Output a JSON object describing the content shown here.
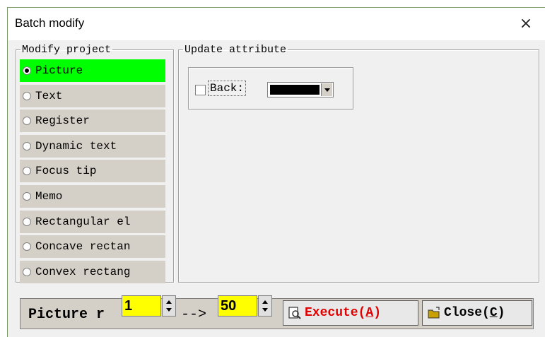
{
  "window": {
    "title": "Batch modify",
    "close_glyph": "×"
  },
  "modify_project": {
    "legend": "Modify project",
    "items": [
      {
        "label": "Picture",
        "selected": true
      },
      {
        "label": "Text",
        "selected": false
      },
      {
        "label": "Register",
        "selected": false
      },
      {
        "label": "Dynamic text",
        "selected": false
      },
      {
        "label": "Focus tip",
        "selected": false
      },
      {
        "label": "Memo",
        "selected": false
      },
      {
        "label": "Rectangular el",
        "selected": false
      },
      {
        "label": "Concave rectan",
        "selected": false
      },
      {
        "label": "Convex rectang",
        "selected": false
      }
    ]
  },
  "update_attribute": {
    "legend": "Update attribute",
    "back_label": "Back:",
    "back_checked": false,
    "back_color": "#000000"
  },
  "range": {
    "label": "Picture r",
    "from_value": "1",
    "arrow": "-->",
    "to_value": "50"
  },
  "buttons": {
    "execute_text": "Execute(",
    "execute_key": "A",
    "execute_close": ")",
    "close_text": "Close(",
    "close_key": "C",
    "close_close": ")"
  },
  "colors": {
    "selected_bg": "#00ff00",
    "input_bg": "#ffff00",
    "execute_color": "#e00000"
  }
}
